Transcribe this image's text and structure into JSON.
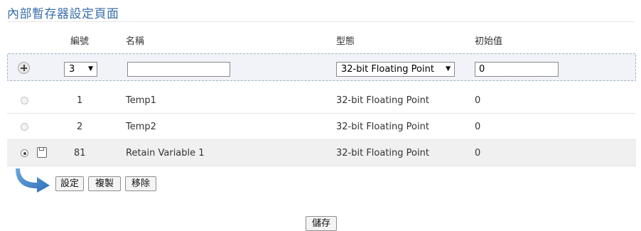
{
  "page": {
    "title": "內部暫存器設定頁面"
  },
  "table": {
    "headers": {
      "number": "編號",
      "name": "名稱",
      "type": "型態",
      "initial": "初始值"
    }
  },
  "add_row": {
    "number_select": "3",
    "name_value": "",
    "type_select": "32-bit Floating Point",
    "initial_value": "0"
  },
  "rows": [
    {
      "number": "1",
      "name": "Temp1",
      "type": "32-bit Floating Point",
      "initial": "0",
      "selected": false,
      "saved": false
    },
    {
      "number": "2",
      "name": "Temp2",
      "type": "32-bit Floating Point",
      "initial": "0",
      "selected": false,
      "saved": false
    },
    {
      "number": "81",
      "name": "Retain Variable 1",
      "type": "32-bit Floating Point",
      "initial": "0",
      "selected": true,
      "saved": true
    }
  ],
  "actions": {
    "set": "設定",
    "copy": "複製",
    "remove": "移除"
  },
  "footer": {
    "save": "儲存"
  },
  "icons": {
    "add": "plus-circle-icon",
    "arrow": "curved-arrow-icon",
    "retain": "floppy-disk-icon",
    "dropdown": "caret-down-icon"
  }
}
